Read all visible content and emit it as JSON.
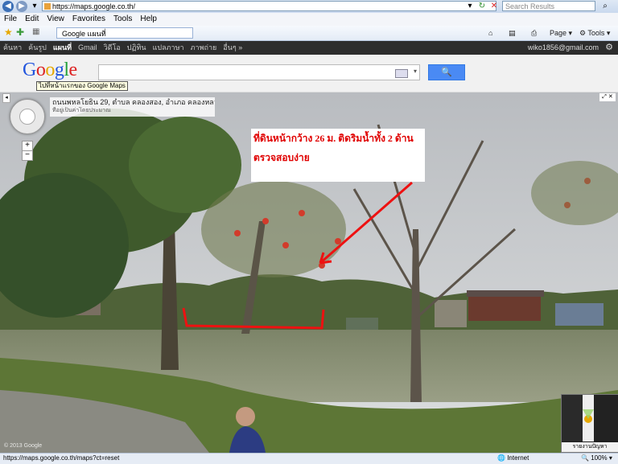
{
  "browser": {
    "url": "https://maps.google.co.th/",
    "search_placeholder": "Search Results",
    "menu": [
      "File",
      "Edit",
      "View",
      "Favorites",
      "Tools",
      "Help"
    ],
    "tab_title": "Google แผนที่",
    "commands": {
      "page": "Page",
      "tools": "Tools"
    }
  },
  "google_bar": {
    "items": [
      "ค้นหา",
      "ค้นรูป",
      "แผนที่",
      "Gmail",
      "วิดีโอ",
      "ปฏิทิน",
      "แปลภาษา",
      "ภาพถ่าย",
      "อื่นๆ »"
    ],
    "selected_index": 2,
    "email": "wiko1856@gmail.com"
  },
  "header": {
    "logo_text": "Google",
    "tooltip": "ไปที่หน้าแรกของ Google Maps",
    "search_value": "",
    "search_button": "🔍"
  },
  "streetview": {
    "address_line1": "ถนนพหลโยธิน 29, ตำบล คลองสอง, อำเภอ คลองหลวง, ปทุมธานี, ไทย",
    "address_line2": "ที่อยู่เป็นค่าโดยประมาณ",
    "note_line1": "ที่ดินหน้ากว้าง 26 ม. ติดริมน้ำทั้ง 2 ด้าน",
    "note_line2": "ตรวจสอบง่าย",
    "copyright": "© 2013 Google",
    "minimap_label": "รายงานปัญหา",
    "zoom_in": "+",
    "zoom_out": "−",
    "arrow_color": "#ee1111"
  },
  "status": {
    "url": "https://maps.google.co.th/maps?ct=reset",
    "zone": "Internet",
    "zoom": "100%"
  }
}
